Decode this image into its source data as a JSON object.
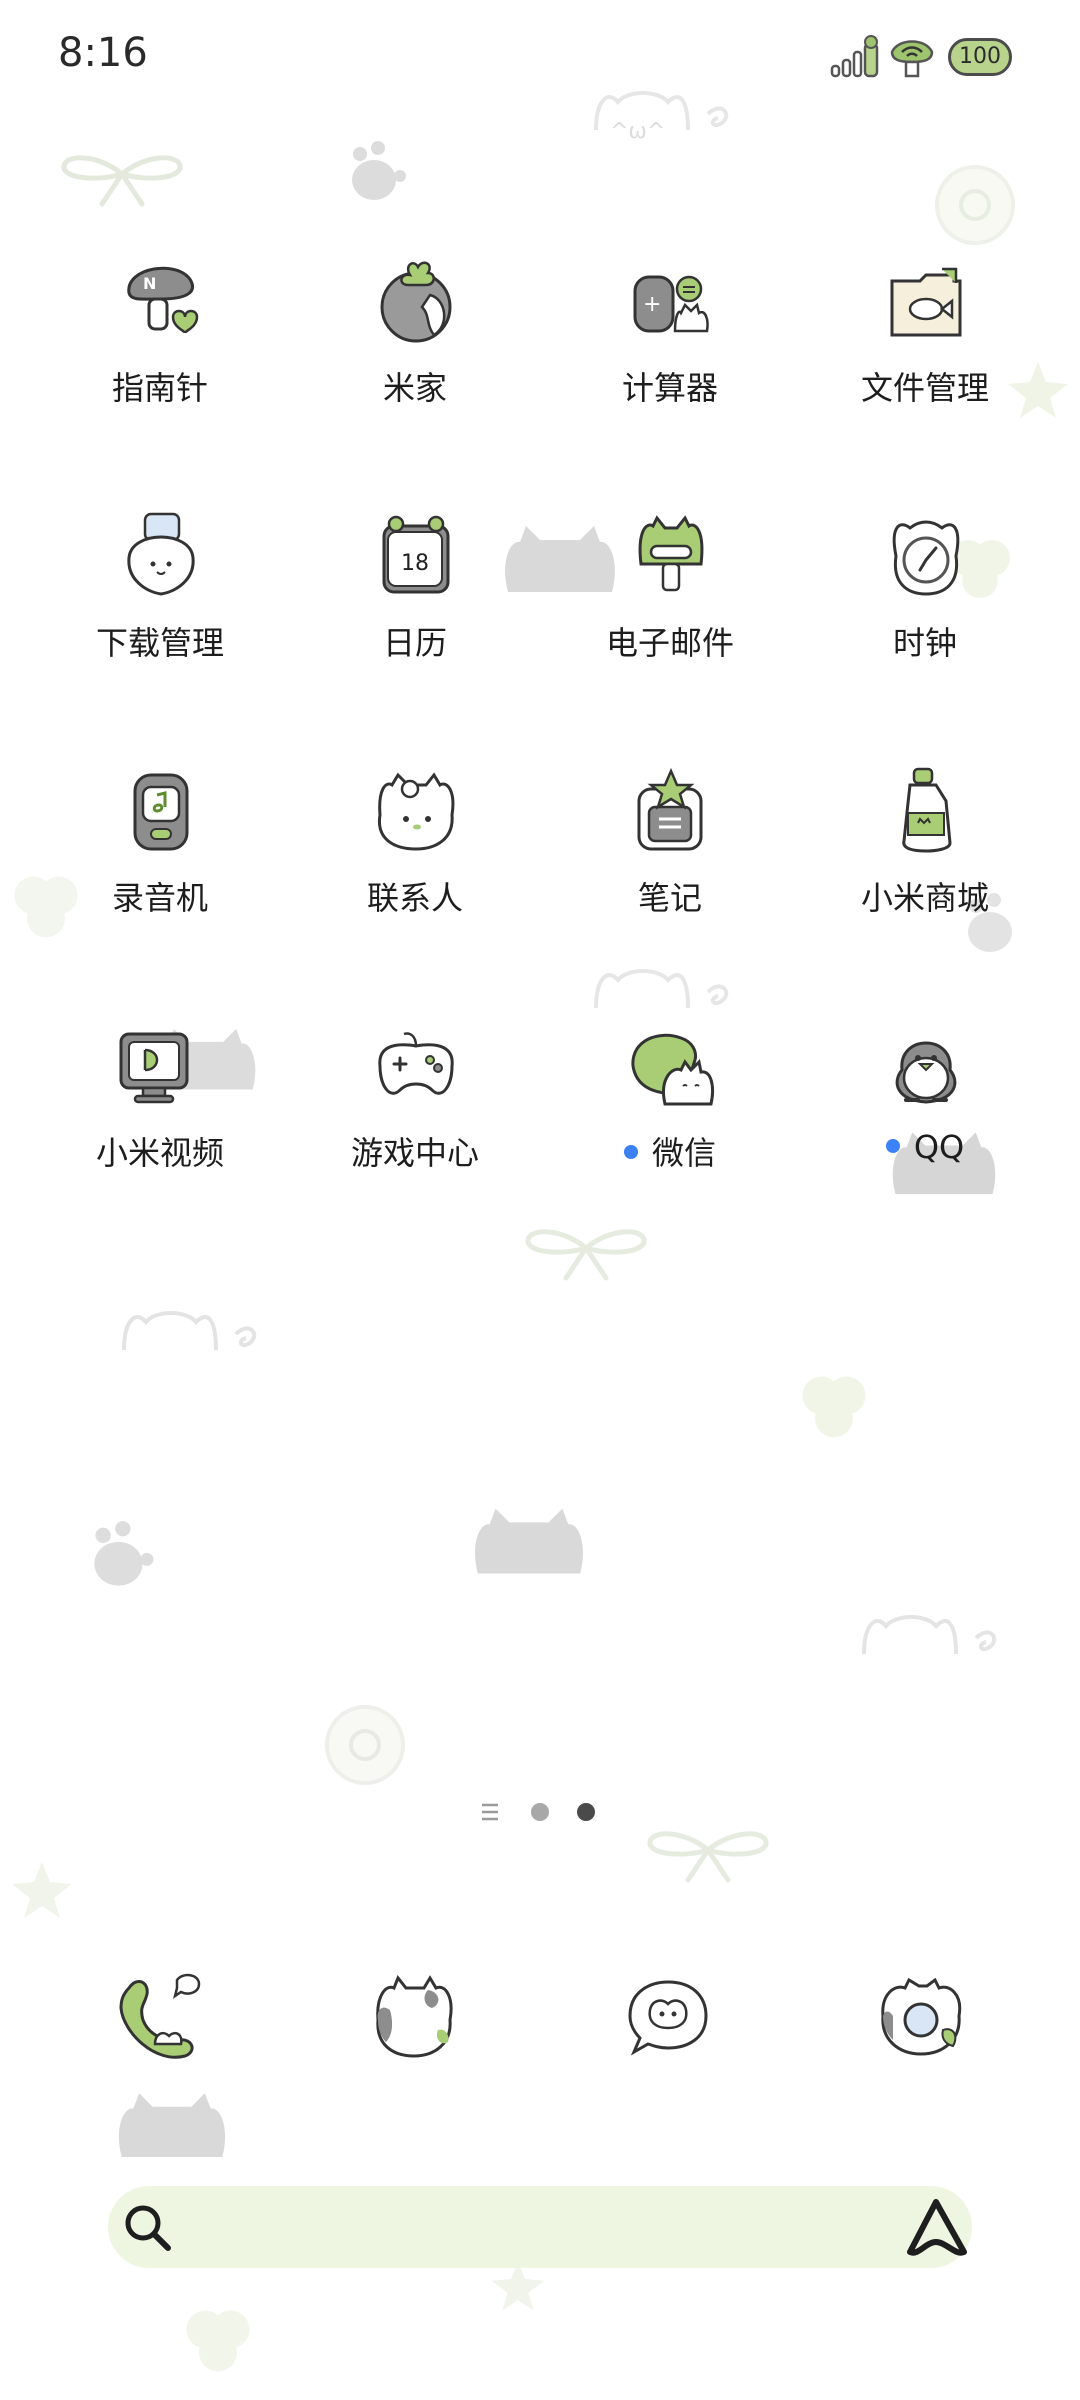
{
  "status_bar": {
    "time": "8:16",
    "battery": "100"
  },
  "apps": [
    {
      "label": "指南针",
      "icon": "compass-mushroom-icon",
      "dot": false
    },
    {
      "label": "米家",
      "icon": "mijia-planet-icon",
      "dot": false
    },
    {
      "label": "计算器",
      "icon": "calculator-cat-icon",
      "dot": false
    },
    {
      "label": "文件管理",
      "icon": "folder-fish-icon",
      "dot": false
    },
    {
      "label": "下载管理",
      "icon": "download-ghost-icon",
      "dot": false
    },
    {
      "label": "日历",
      "icon": "calendar-icon",
      "dot": false,
      "icon_text": "18"
    },
    {
      "label": "电子邮件",
      "icon": "email-frog-icon",
      "dot": false
    },
    {
      "label": "时钟",
      "icon": "clock-icon",
      "dot": false
    },
    {
      "label": "录音机",
      "icon": "recorder-icon",
      "dot": false
    },
    {
      "label": "联系人",
      "icon": "contacts-kitty-icon",
      "dot": false
    },
    {
      "label": "笔记",
      "icon": "notes-star-icon",
      "dot": false
    },
    {
      "label": "小米商城",
      "icon": "mall-bottle-icon",
      "dot": false
    },
    {
      "label": "小米视频",
      "icon": "video-monitor-icon",
      "dot": false
    },
    {
      "label": "游戏中心",
      "icon": "gamepad-icon",
      "dot": false
    },
    {
      "label": "微信",
      "icon": "wechat-cat-icon",
      "dot": true
    },
    {
      "label": "QQ",
      "icon": "qq-penguin-icon",
      "dot": true
    }
  ],
  "dock": [
    {
      "icon": "phone-icon"
    },
    {
      "icon": "cow-contacts-icon"
    },
    {
      "icon": "messages-icon"
    },
    {
      "icon": "camera-icon"
    }
  ],
  "search": {
    "search_icon": "search-icon",
    "assistant_icon": "assistant-icon"
  },
  "colors": {
    "accent_green": "#b8d48c",
    "search_bg": "#eef6e2",
    "badge_blue": "#3b82f6"
  }
}
